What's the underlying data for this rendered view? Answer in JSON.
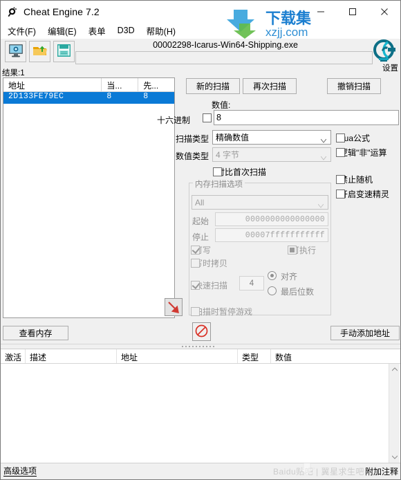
{
  "window": {
    "title": "Cheat Engine 7.2",
    "app_icon": "cheat-engine-icon",
    "minimize": "—",
    "maximize": "□",
    "close": "✕"
  },
  "menu": {
    "items": [
      {
        "label": "文件(F)",
        "text": "文件",
        "accel": "F"
      },
      {
        "label": "编辑(E)",
        "text": "编辑",
        "accel": "E"
      },
      {
        "label": "表单",
        "text": "表单",
        "accel": ""
      },
      {
        "label": "D3D",
        "text": "D3D",
        "accel": ""
      },
      {
        "label": "帮助(H)",
        "text": "帮助",
        "accel": "H"
      }
    ]
  },
  "toolbar": {
    "process_button_icon": "process-monitor-icon",
    "open_button_icon": "open-folder-icon",
    "save_button_icon": "save-floppy-icon",
    "process_title": "00002298-Icarus-Win64-Shipping.exe",
    "process_field_value": "",
    "logo_icon": "cheat-engine-logo-icon",
    "settings_label": "设置"
  },
  "results": {
    "count_label": "结果:1",
    "columns": [
      "地址",
      "当...",
      "先..."
    ],
    "rows": [
      {
        "address": "2D133FE79EC",
        "current": "8",
        "previous": "8"
      }
    ]
  },
  "scan": {
    "new_scan": "新的扫描",
    "next_scan": "再次扫描",
    "undo_scan": "撤销扫描",
    "value_label": "数值:",
    "hex_label": "十六进制",
    "hex_checked": false,
    "value": "8",
    "scan_type_label": "扫描类型",
    "scan_type_value": "精确数值",
    "value_type_label": "数值类型",
    "value_type_value": "4 字节",
    "lua_formula": "Lua公式",
    "lua_checked": false,
    "not_logic": "逻辑\"非\"运算",
    "not_logic_checked": false,
    "no_random": "禁止随机",
    "no_random_checked": false,
    "speedhack": "开启变速精灵",
    "speedhack_checked": false,
    "compare_first_scan": "对比首次扫描",
    "compare_first_checked": false,
    "arrow_icon": "red-diagonal-arrow-icon"
  },
  "memory_options": {
    "group_title": "内存扫描选项",
    "region_value": "All",
    "start_label": "起始",
    "start_value": "0000000000000000",
    "stop_label": "停止",
    "stop_value": "00007fffffffffff",
    "writable_label": "可写",
    "writable_checked": true,
    "executable_label": "可执行",
    "executable_state": "indeterminate",
    "copy_on_write_label": "写时拷贝",
    "copy_on_write_checked": false,
    "fast_scan_label": "快速扫描",
    "fast_scan_checked": true,
    "fast_scan_value": "4",
    "align_label": "对齐",
    "align_selected": true,
    "last_digits_label": "最后位数",
    "last_digits_selected": false,
    "pause_while_scanning_label": "扫描时暂停游戏",
    "pause_while_scanning_checked": false
  },
  "actions": {
    "view_memory": "查看内存",
    "stop_icon": "stop-prohibited-icon",
    "manual_add_address": "手动添加地址"
  },
  "cheat_table": {
    "columns": [
      "激活",
      "描述",
      "地址",
      "类型",
      "数值"
    ],
    "rows": []
  },
  "statusbar": {
    "advanced_options": "高级选项",
    "attach_comment": "附加注释"
  },
  "watermarks": {
    "main_text": "下载集",
    "main_sub": "xzjj.com",
    "baidu_text": "Baidu贴吧 | 翼星求生吧"
  },
  "colors": {
    "accent_selection": "#0a7ad6",
    "window_bg": "#f0f0f0",
    "list_bg": "#ffffff",
    "group_text": "#8a8a8a",
    "watermark_blue": "#1c7fd0",
    "watermark_green": "#62bb46",
    "stop_red": "#d93025",
    "arrow_red": "#d03a33"
  }
}
